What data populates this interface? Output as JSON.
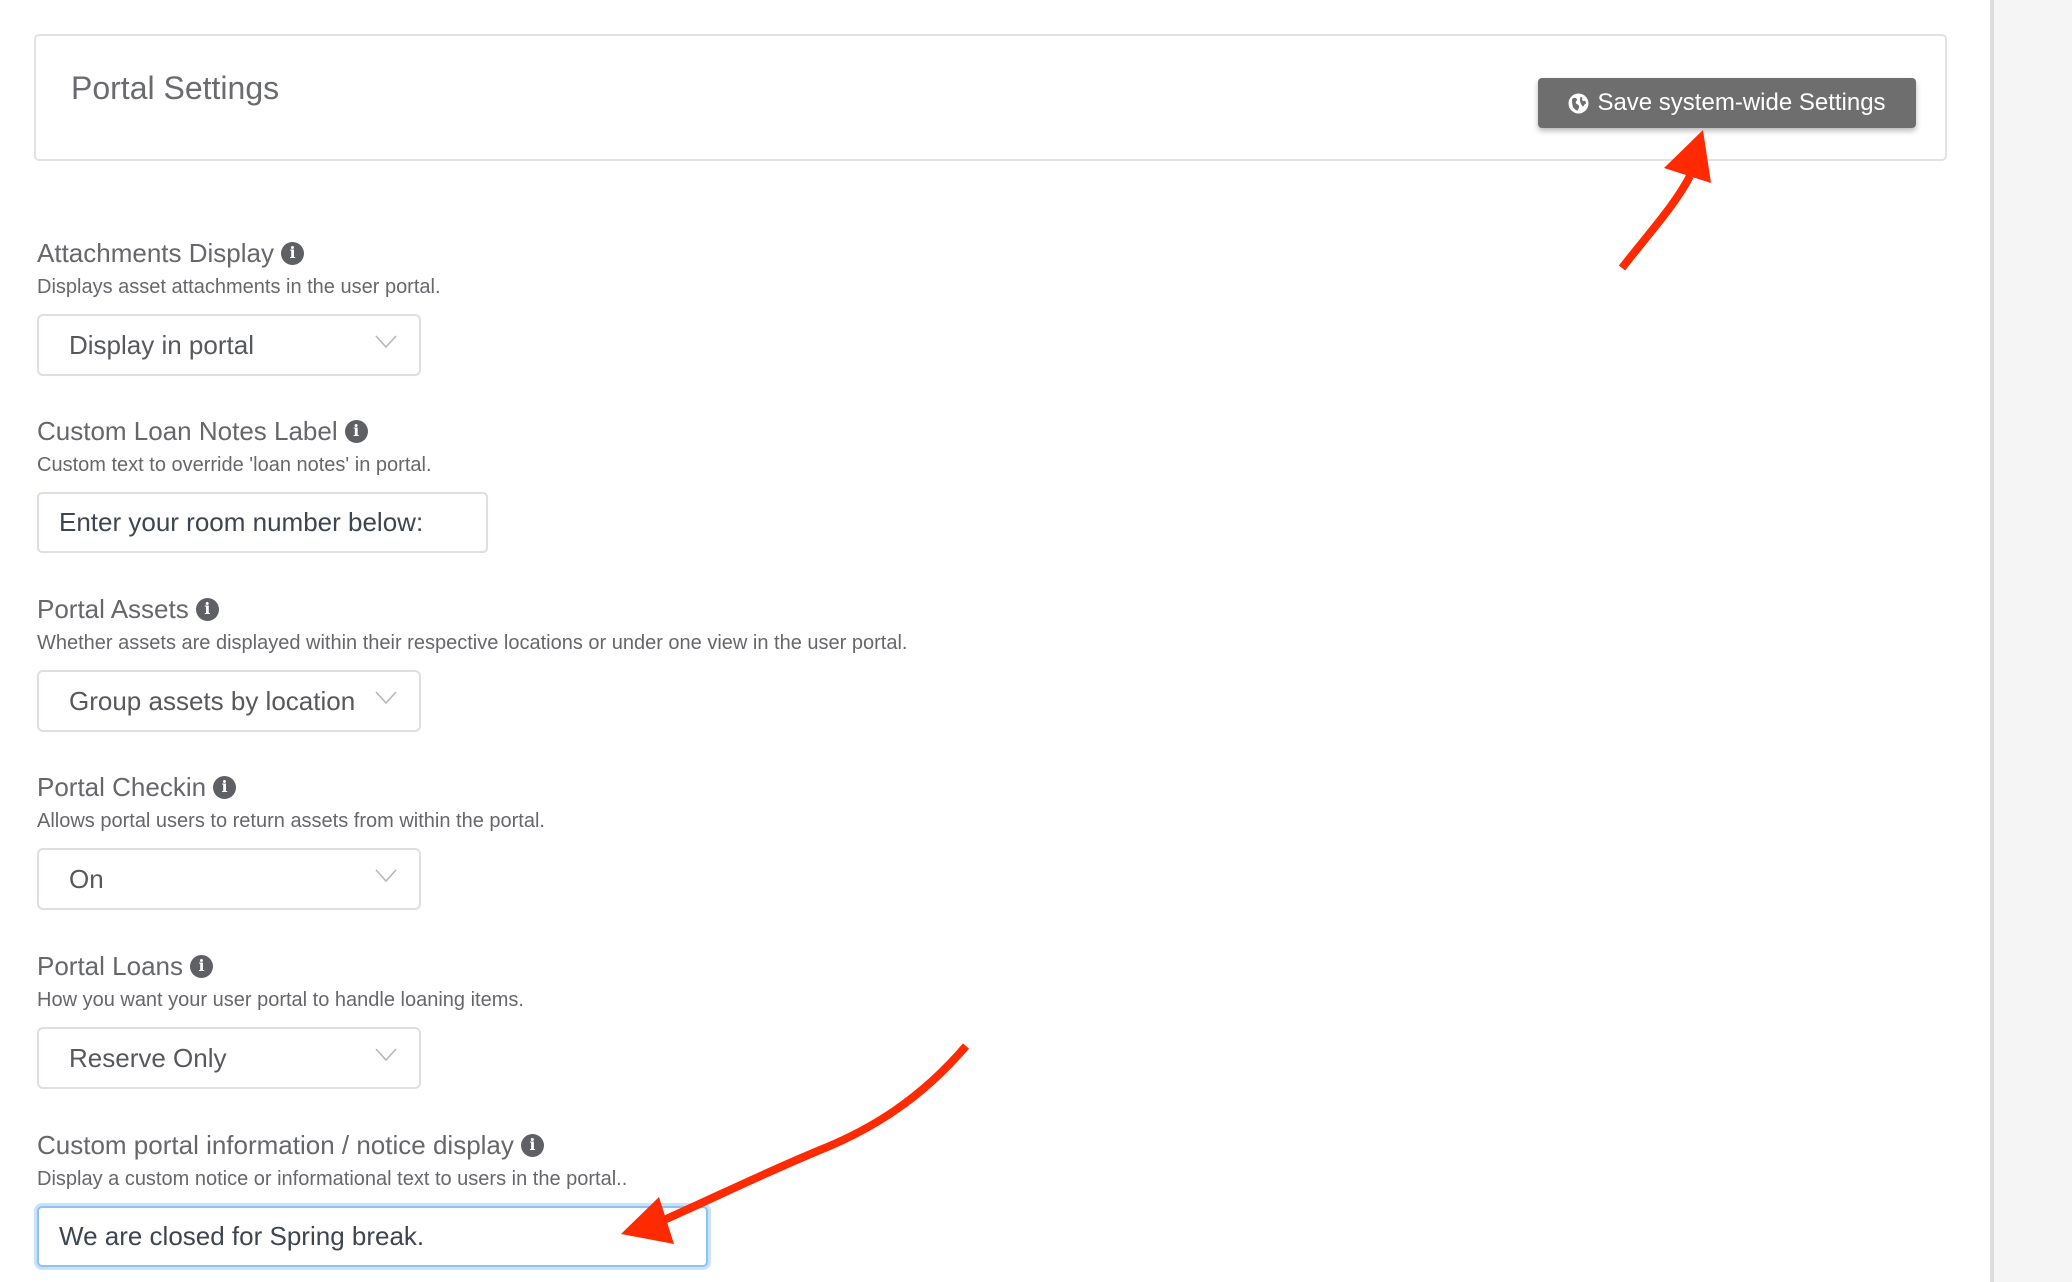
{
  "header": {
    "title": "Portal Settings",
    "save_button": {
      "label": "Save system-wide Settings",
      "icon": "globe-icon"
    }
  },
  "fields": [
    {
      "label": "Attachments Display",
      "description": "Displays asset attachments in the user portal.",
      "type": "select",
      "value": "Display in portal"
    },
    {
      "label": "Custom Loan Notes Label",
      "description": "Custom text to override 'loan notes' in portal.",
      "type": "text",
      "value": "Enter your room number below:"
    },
    {
      "label": "Portal Assets",
      "description": "Whether assets are displayed within their respective locations or under one view in the user portal.",
      "type": "select",
      "value": "Group assets by location"
    },
    {
      "label": "Portal Checkin",
      "description": "Allows portal users to return assets from within the portal.",
      "type": "select",
      "value": "On"
    },
    {
      "label": "Portal Loans",
      "description": "How you want your user portal to handle loaning items.",
      "type": "select",
      "value": "Reserve Only"
    },
    {
      "label": "Custom portal information / notice display",
      "description": "Display a custom notice or informational text to users in the portal..",
      "type": "text",
      "value": "We are closed for Spring break.",
      "focused": true
    }
  ],
  "icons": {
    "info": "info-circle-icon",
    "dropdown": "chevron-down-icon"
  },
  "annotations": {
    "arrow_color": "#ff2a00",
    "targets": [
      "save-system-wide-settings-button",
      "custom-portal-notice-input"
    ]
  },
  "colors": {
    "button_bg": "#6e6e6e",
    "focus_ring": "#8ec1f5",
    "border": "#dcdfe6"
  }
}
